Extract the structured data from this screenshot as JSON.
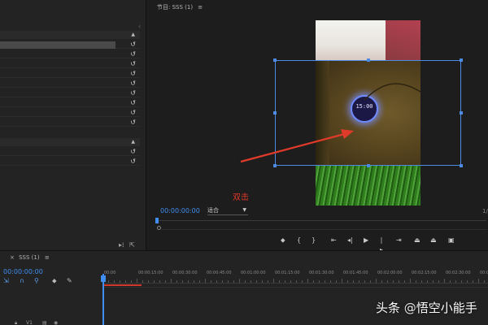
{
  "program": {
    "tab_label": "节目: SSS (1)",
    "timecode": "00:00:00:00",
    "fit_value": "适合",
    "fraction_label": "1/",
    "annotation": "双击",
    "overlay_time": "15:00",
    "transport": {
      "marker": "marker-icon",
      "in_point": "{",
      "out_point": "}",
      "go_to_in": "go-to-in-icon",
      "step_back": "step-back-icon",
      "play": "play-icon",
      "step_forward": "step-forward-icon",
      "go_to_out": "go-to-out-icon",
      "lift": "lift-icon",
      "extract": "extract-icon",
      "export_frame": "camera-icon"
    }
  },
  "timeline": {
    "tab_label": "SSS (1)",
    "timecode": "00:00:00:00",
    "ruler_labels": [
      "00:00",
      "00:00:15:00",
      "00:00:30:00",
      "00:00:45:00",
      "00:01:00:00",
      "00:01:15:00",
      "00:01:30:00",
      "00:01:45:00",
      "00:02:00:00",
      "00:02:15:00",
      "00:02:30:00",
      "00:02:45:00"
    ]
  },
  "watermark": {
    "prefix": "头条",
    "separator": "@",
    "author": "悟空小能手"
  },
  "colors": {
    "accent_blue": "#3f8ef0",
    "annotation_red": "#e03a2a",
    "bbox_blue": "#4d8be3"
  }
}
